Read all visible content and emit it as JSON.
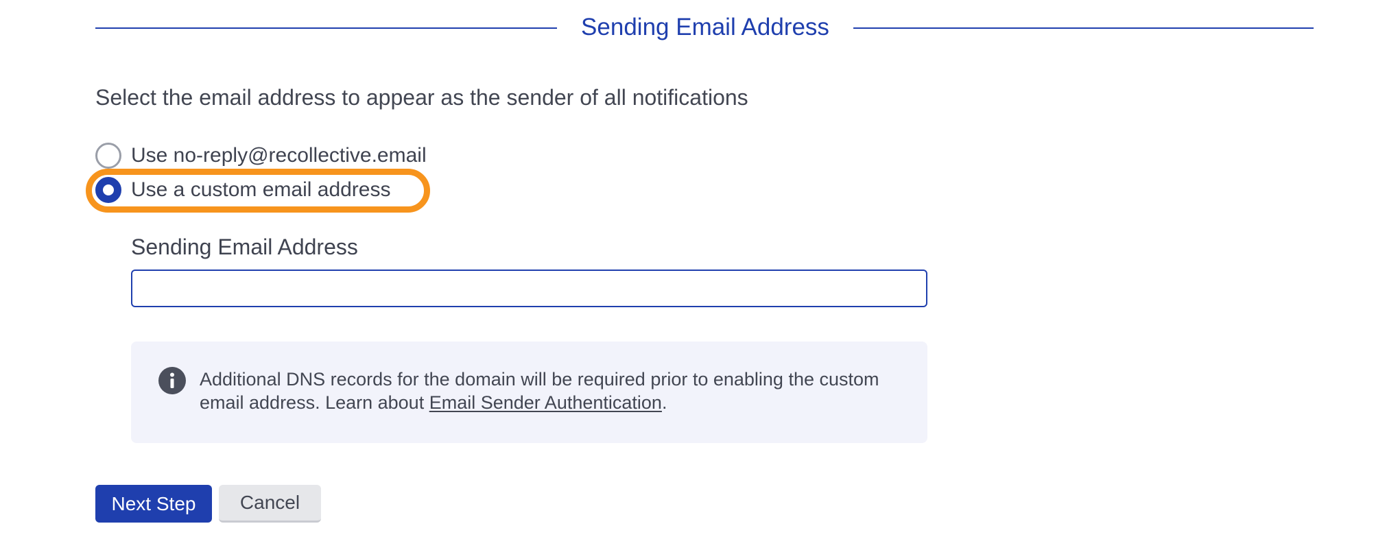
{
  "section": {
    "title": "Sending Email Address"
  },
  "instruction": "Select the email address to appear as the sender of all notifications",
  "sender_options": [
    {
      "label": "Use no-reply@recollective.email",
      "selected": false
    },
    {
      "label": "Use a custom email address",
      "selected": true
    }
  ],
  "email_field": {
    "label": "Sending Email Address",
    "value": "",
    "placeholder": ""
  },
  "info": {
    "icon": "info-icon",
    "text_before": "Additional DNS records for the domain will be required prior to enabling the custom email address. Learn about ",
    "link_text": "Email Sender Authentication",
    "text_after": "."
  },
  "buttons": {
    "next": "Next Step",
    "cancel": "Cancel"
  },
  "colors": {
    "accent": "#1f3fae",
    "highlight": "#f7941d",
    "info_background": "#f2f3fb",
    "text": "#3f4350"
  }
}
